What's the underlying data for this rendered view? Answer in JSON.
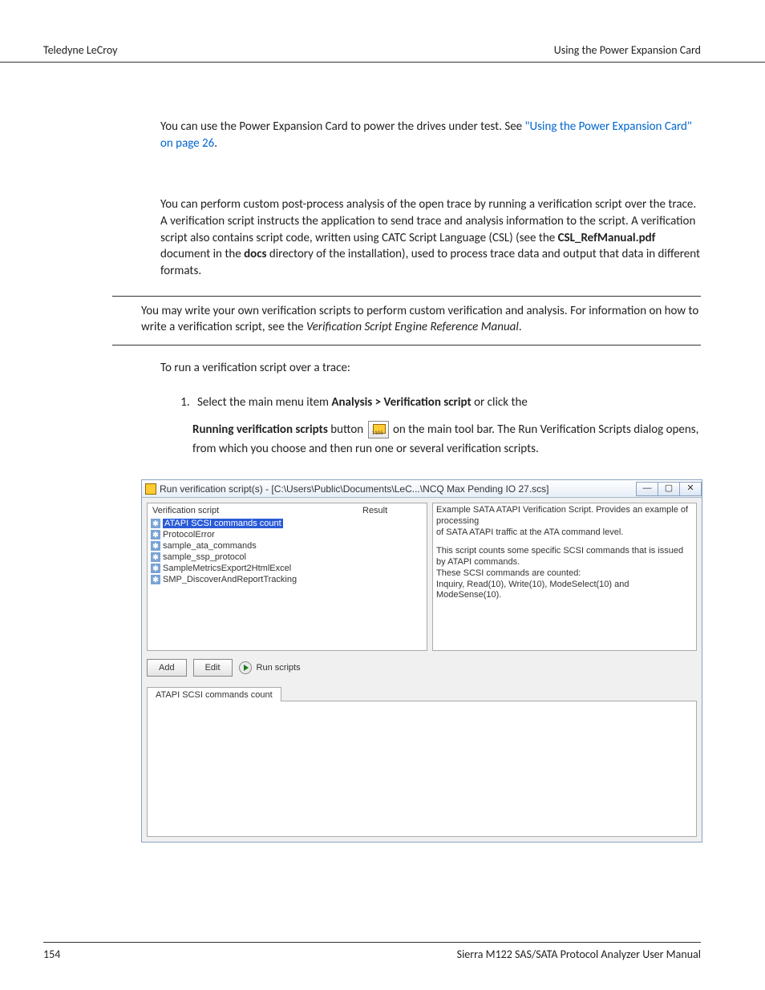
{
  "header": {
    "left": "Teledyne LeCroy",
    "right": "Using the Power Expansion Card"
  },
  "body": {
    "para1_a": "You can use the Power Expansion Card to power the drives under test. See ",
    "para1_link": "\"Using the Power Expansion Card\" on page 26",
    "para1_b": ".",
    "para2_a": "You can perform custom post-process analysis of the open trace by running a verification script over the trace. A verification script instructs the application to send trace and analysis information to the script. A verification script also contains script code, written using CATC Script Language (CSL) (see the ",
    "para2_bold1": "CSL_RefManual.pdf",
    "para2_b": " document in the ",
    "para2_bold2": "docs",
    "para2_c": " directory of the installation), used to process trace data and output that data in different formats.",
    "note_a": "You may write your own verification scripts to perform custom verification and analysis. For information on how to write a verification script, see the ",
    "note_ital": "Verification Script Engine Reference Manual",
    "note_b": ".",
    "para3": "To run a verification script over a trace:",
    "step1_a": "Select the main menu item ",
    "step1_bold": "Analysis > Verification script",
    "step1_b": " or click the",
    "step1_body_bold": "Running verification scripts",
    "step1_body_a": " button ",
    "step1_body_b": " on the main tool bar. The Run Verification Scripts dialog opens, from which you choose and then run one or several verification scripts."
  },
  "dialog": {
    "title": "Run verification script(s) - [C:\\Users\\Public\\Documents\\LeC...\\NCQ Max Pending IO 27.scs]",
    "cols": {
      "c1": "Verification script",
      "c2": "Result"
    },
    "scripts": [
      {
        "label": "ATAPI SCSI commands count",
        "selected": true
      },
      {
        "label": "ProtocolError",
        "selected": false
      },
      {
        "label": "sample_ata_commands",
        "selected": false
      },
      {
        "label": "sample_ssp_protocol",
        "selected": false
      },
      {
        "label": "SampleMetricsExport2HtmlExcel",
        "selected": false
      },
      {
        "label": "SMP_DiscoverAndReportTracking",
        "selected": false
      }
    ],
    "desc_l1": "Example SATA ATAPI Verification Script. Provides an example of processing",
    "desc_l2": "of SATA ATAPI traffic at the ATA command level.",
    "desc_l3": "This script counts some specific SCSI commands that is issued by ATAPI commands.",
    "desc_l4": "These SCSI commands are counted:",
    "desc_l5": "Inquiry, Read(10), Write(10), ModeSelect(10) and ModeSense(10).",
    "buttons": {
      "add": "Add",
      "edit": "Edit",
      "run": "Run scripts"
    },
    "tab": "ATAPI SCSI commands count"
  },
  "footer": {
    "pagenum": "154",
    "manual": "Sierra M122 SAS/SATA Protocol Analyzer User Manual"
  }
}
